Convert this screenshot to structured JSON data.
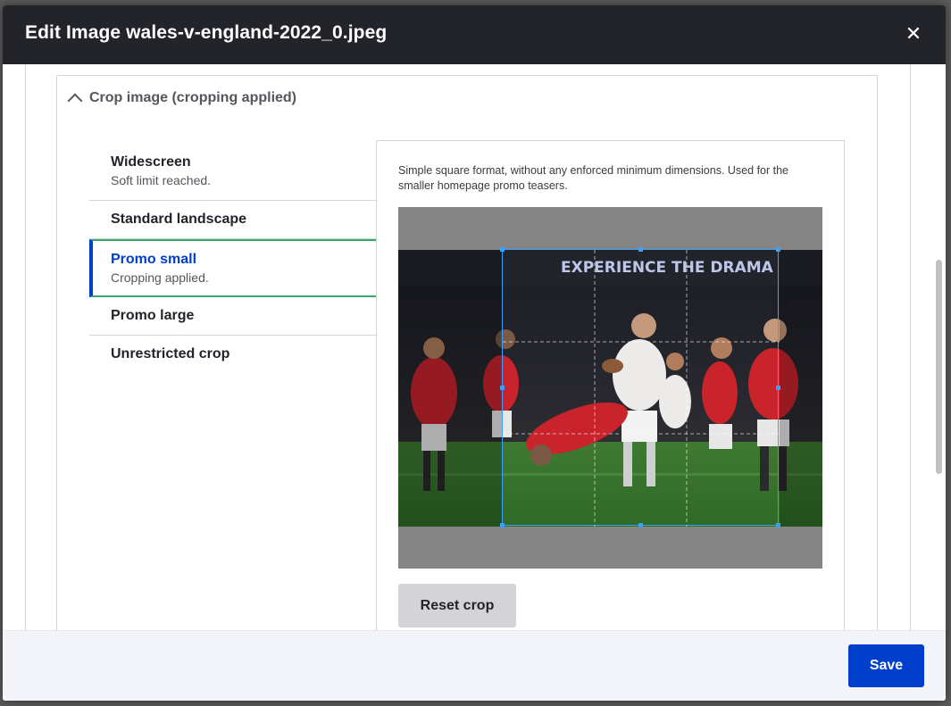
{
  "dialog": {
    "title": "Edit Image wales-v-england-2022_0.jpeg",
    "close_icon": "close-icon"
  },
  "details": {
    "summary": "Crop image (cropping applied)",
    "expanded": true
  },
  "tabs": [
    {
      "label": "Widescreen",
      "status": "Soft limit reached.",
      "active": false
    },
    {
      "label": "Standard landscape",
      "status": "",
      "active": false
    },
    {
      "label": "Promo small",
      "status": "Cropping applied.",
      "active": true
    },
    {
      "label": "Promo large",
      "status": "",
      "active": false
    },
    {
      "label": "Unrestricted crop",
      "status": "",
      "active": false
    }
  ],
  "panel": {
    "description": "Simple square format, without any enforced minimum dimensions. Used for the smaller homepage promo teasers.",
    "photo_banner_text": "EXPERIENCE THE DRAMA",
    "reset_label": "Reset crop"
  },
  "footer": {
    "save_label": "Save"
  },
  "colors": {
    "primary": "#003ecc",
    "active_accent": "#3aa76d",
    "titlebar": "#232429",
    "crop_outline": "#3aa0ff"
  }
}
